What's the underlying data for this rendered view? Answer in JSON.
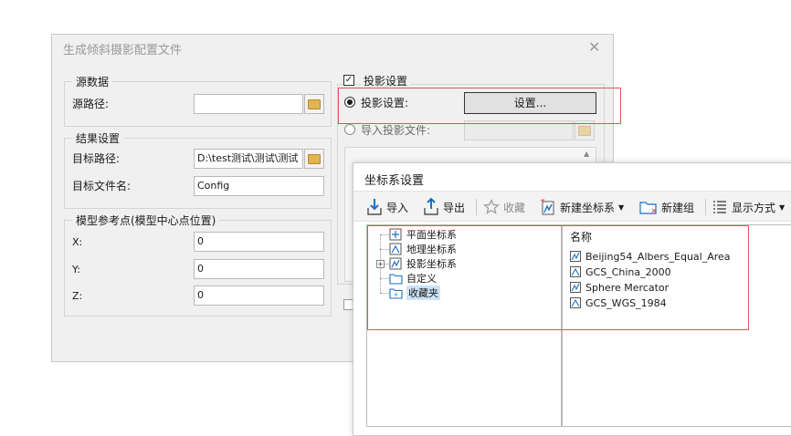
{
  "main_dialog": {
    "title": "生成倾斜摄影配置文件",
    "source_group": {
      "legend": "源数据",
      "path_label": "源路径:",
      "path_value": ""
    },
    "result_group": {
      "legend": "结果设置",
      "target_path_label": "目标路径:",
      "target_path_value": "D:\\test测试\\测试\\测试",
      "target_name_label": "目标文件名:",
      "target_name_value": "Config"
    },
    "ref_group": {
      "legend": "模型参考点(模型中心点位置)",
      "x_label": "X:",
      "x_value": "0",
      "y_label": "Y:",
      "y_value": "0",
      "z_label": "Z:",
      "z_value": "0"
    },
    "projection_group": {
      "legend": "投影设置",
      "option_set_label": "投影设置:",
      "set_button_label": "设置...",
      "option_import_label": "导入投影文件:",
      "import_path_value": ""
    }
  },
  "coord_dialog": {
    "title": "坐标系设置",
    "toolbar": {
      "import_label": "导入",
      "export_label": "导出",
      "favorite_label": "收藏",
      "new_crs_label": "新建坐标系",
      "new_group_label": "新建组",
      "display_mode_label": "显示方式"
    },
    "tree": [
      {
        "label": "平面坐标系",
        "icon": "plane-crs-icon"
      },
      {
        "label": "地理坐标系",
        "icon": "geo-crs-icon"
      },
      {
        "label": "投影坐标系",
        "icon": "proj-crs-icon"
      },
      {
        "label": "自定义",
        "icon": "folder-icon"
      },
      {
        "label": "收藏夹",
        "icon": "favorites-folder-icon"
      }
    ],
    "list": {
      "column_header": "名称",
      "items": [
        {
          "label": "Beijing54_Albers_Equal_Area",
          "icon": "proj-crs-icon"
        },
        {
          "label": "GCS_China_2000",
          "icon": "geo-crs-icon"
        },
        {
          "label": "Sphere Mercator",
          "icon": "proj-crs-icon"
        },
        {
          "label": "GCS_WGS_1984",
          "icon": "geo-crs-icon"
        }
      ]
    }
  },
  "colors": {
    "highlight_box": "#e05555",
    "selection": "#cce4f7",
    "dialog_bg": "#f0f0f0"
  }
}
